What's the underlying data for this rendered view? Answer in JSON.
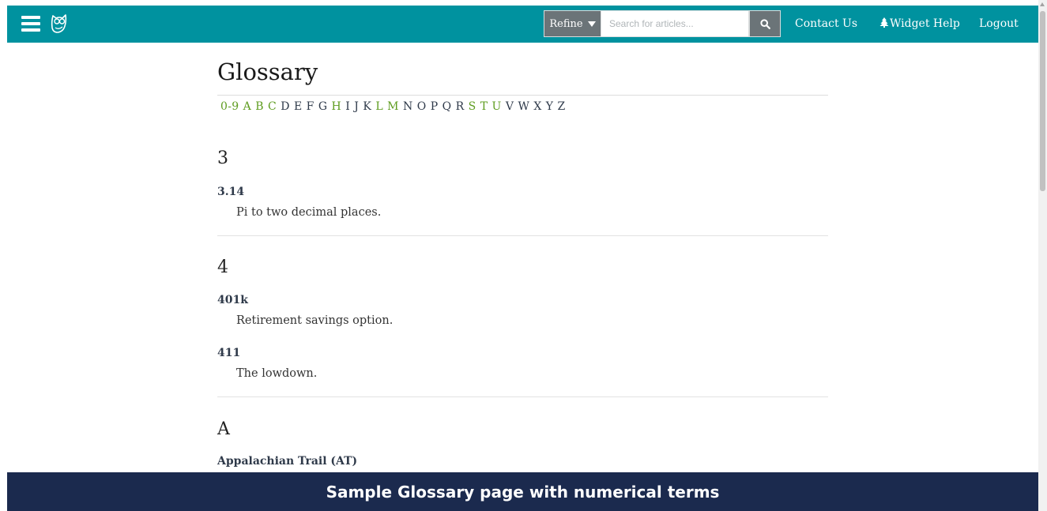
{
  "header": {
    "refine_label": "Refine",
    "search_placeholder": "Search for articles...",
    "nav": {
      "contact": "Contact Us",
      "widget_help": "Widget Help",
      "logout": "Logout"
    },
    "colors": {
      "bar": "#00929f",
      "control": "#6b7478"
    }
  },
  "page": {
    "title": "Glossary",
    "letters": [
      {
        "label": "0-9",
        "active": true
      },
      {
        "label": "A",
        "active": true
      },
      {
        "label": "B",
        "active": true
      },
      {
        "label": "C",
        "active": true
      },
      {
        "label": "D",
        "active": false
      },
      {
        "label": "E",
        "active": false
      },
      {
        "label": "F",
        "active": false
      },
      {
        "label": "G",
        "active": false
      },
      {
        "label": "H",
        "active": true
      },
      {
        "label": "I",
        "active": false
      },
      {
        "label": "J",
        "active": false
      },
      {
        "label": "K",
        "active": false
      },
      {
        "label": "L",
        "active": true
      },
      {
        "label": "M",
        "active": true
      },
      {
        "label": "N",
        "active": false
      },
      {
        "label": "O",
        "active": false
      },
      {
        "label": "P",
        "active": false
      },
      {
        "label": "Q",
        "active": false
      },
      {
        "label": "R",
        "active": false
      },
      {
        "label": "S",
        "active": true
      },
      {
        "label": "T",
        "active": true
      },
      {
        "label": "U",
        "active": true
      },
      {
        "label": "V",
        "active": false
      },
      {
        "label": "W",
        "active": false
      },
      {
        "label": "X",
        "active": false
      },
      {
        "label": "Y",
        "active": false
      },
      {
        "label": "Z",
        "active": false
      }
    ],
    "sections": [
      {
        "heading": "3",
        "entries": [
          {
            "term": "3.14",
            "definition": "Pi to two decimal places."
          }
        ]
      },
      {
        "heading": "4",
        "entries": [
          {
            "term": "401k",
            "definition": "Retirement savings option."
          },
          {
            "term": "411",
            "definition": "The lowdown."
          }
        ]
      },
      {
        "heading": "A",
        "entries": [
          {
            "term": "Appalachian Trail (AT)",
            "definition": ""
          }
        ]
      }
    ],
    "letter_colors": {
      "active": "#5e9c1f",
      "inactive": "#2f3a4a"
    }
  },
  "caption": "Sample Glossary page with numerical terms"
}
